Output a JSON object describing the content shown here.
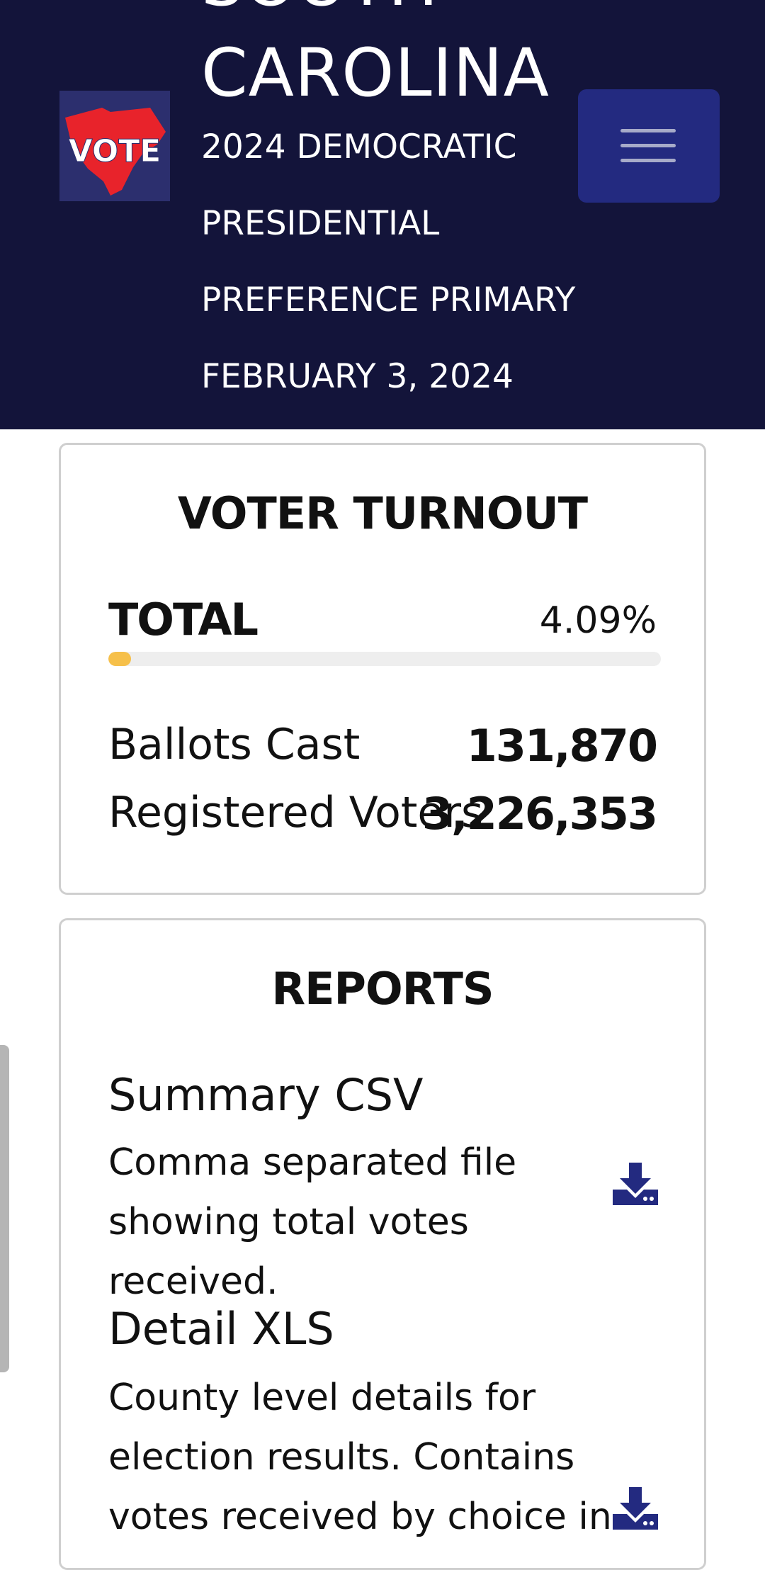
{
  "header": {
    "logo_text": "VOTE",
    "state_line1": "SOUTH",
    "state_line2": "CAROLINA",
    "subtitle_lines": [
      "2024 DEMOCRATIC",
      "PRESIDENTIAL",
      "PREFERENCE PRIMARY",
      "FEBRUARY 3, 2024"
    ],
    "menu_icon": "hamburger-menu-icon"
  },
  "turnout": {
    "title": "VOTER TURNOUT",
    "total_label": "TOTAL",
    "total_percent": "4.09%",
    "progress_fraction": 0.0409,
    "ballots_label": "Ballots Cast",
    "ballots_value": "131,870",
    "registered_label": "Registered Voters",
    "registered_value": "3,226,353"
  },
  "reports": {
    "title": "REPORTS",
    "items": [
      {
        "name": "Summary CSV",
        "description": "Comma separated file showing total votes received.",
        "icon": "download-icon"
      },
      {
        "name": "Detail XLS",
        "description": "County level details for election results. Contains votes received by choice in",
        "icon": "download-icon"
      }
    ]
  },
  "colors": {
    "header_bg": "#13143a",
    "menu_button_bg": "#232a80",
    "logo_state_red": "#e8232b",
    "progress_fill": "#f6c04a",
    "download_icon": "#232a80"
  }
}
